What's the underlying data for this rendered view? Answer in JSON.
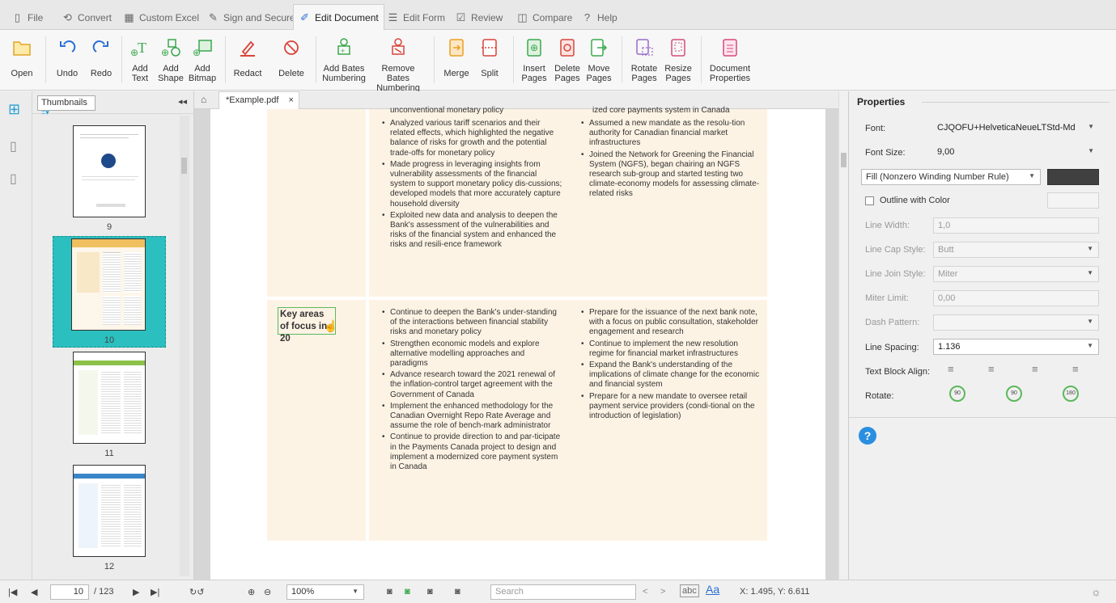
{
  "menu": {
    "tabs": [
      {
        "label": "File",
        "icon": "file-icon"
      },
      {
        "label": "Convert",
        "icon": "convert-icon"
      },
      {
        "label": "Custom Excel",
        "icon": "grid-icon"
      },
      {
        "label": "Sign and Secure",
        "icon": "pen-icon"
      },
      {
        "label": "Edit Document",
        "icon": "edit-icon"
      },
      {
        "label": "Edit Form",
        "icon": "form-icon"
      },
      {
        "label": "Review",
        "icon": "review-icon"
      },
      {
        "label": "Compare",
        "icon": "compare-icon"
      },
      {
        "label": "Help",
        "icon": "help-icon"
      }
    ],
    "active": "Edit Document"
  },
  "ribbon": {
    "open": "Open",
    "undo": "Undo",
    "redo": "Redo",
    "add_text": [
      "Add",
      "Text"
    ],
    "add_shape": [
      "Add",
      "Shape"
    ],
    "add_bitmap": [
      "Add",
      "Bitmap"
    ],
    "redact": "Redact",
    "delete": "Delete",
    "add_bates": [
      "Add Bates",
      "Numbering"
    ],
    "remove_bates": [
      "Remove Bates",
      "Numbering"
    ],
    "merge": "Merge",
    "split": "Split",
    "insert_pages": [
      "Insert",
      "Pages"
    ],
    "delete_pages": [
      "Delete",
      "Pages"
    ],
    "move_pages": [
      "Move",
      "Pages"
    ],
    "rotate_pages": [
      "Rotate",
      "Pages"
    ],
    "resize_pages": [
      "Resize",
      "Pages"
    ],
    "doc_props": [
      "Document",
      "Properties"
    ],
    "colors": {
      "orange": "#e8a020",
      "red": "#d9443a",
      "green": "#3aa84f",
      "purple": "#9a6ac8",
      "pink": "#d64a7a",
      "blue": "#2a6fd6"
    }
  },
  "thumbnails": {
    "selector": "Thumbnails",
    "pages": [
      "9",
      "10",
      "11",
      "12"
    ],
    "selected": "10",
    "highlight": "#2bbfbf"
  },
  "doc_tab": {
    "label": "*Example.pdf",
    "close": "×"
  },
  "document": {
    "top_left_partial": "unconventional monetary policy",
    "top_right_partial": "ized core payments system in Canada",
    "top_left_items": [
      "Analyzed various tariff scenarios and their related effects, which highlighted the negative balance of risks for growth and the potential trade-offs for monetary policy",
      "Made progress in leveraging insights from vulnerability assessments of the financial system to support monetary policy dis-cussions; developed models that more accurately capture household diversity",
      "Exploited new data and analysis to deepen the Bank's assessment of the vulnerabilities and risks of the financial system and enhanced the risks and resili-ence framework"
    ],
    "top_right_items": [
      "Assumed a new mandate as the resolu-tion authority for Canadian financial market infrastructures",
      "Joined the Network for Greening the Financial System (NGFS), began chairing an NGFS research sub-group and started testing two climate-economy models for assessing climate-related risks"
    ],
    "key_areas_label": "Key areas of focus in 20",
    "bottom_left_items": [
      "Continue to deepen the Bank's under-standing of the interactions between financial stability risks and monetary policy",
      "Strengthen economic models and explore alternative modelling approaches and paradigms",
      "Advance research toward the 2021 renewal of the inflation-control target agreement with the Government of Canada",
      "Implement the enhanced methodology for the Canadian Overnight Repo Rate Average and assume the role of bench-mark administrator",
      "Continue to provide direction to and par-ticipate in the Payments Canada project to design and implement a modernized core payment system in Canada"
    ],
    "bottom_right_items": [
      "Prepare for the issuance of the next bank note, with a focus on public consultation, stakeholder engagement and research",
      "Continue to implement the new resolution regime for financial market infrastructures",
      "Expand the Bank's understanding of the implications of climate change for the economic and financial system",
      "Prepare for a new mandate to oversee retail payment service providers (condi-tional on the introduction of legislation)"
    ]
  },
  "properties": {
    "title": "Properties",
    "font_label": "Font:",
    "font_value": "CJQOFU+HelveticaNeueLTStd-Md",
    "font_size_label": "Font Size:",
    "font_size_value": "9,00",
    "fill_value": "Fill (Nonzero Winding Number Rule)",
    "fill_color": "#404040",
    "outline_label": "Outline with Color",
    "line_width_label": "Line Width:",
    "line_width_value": "1,0",
    "line_cap_label": "Line Cap Style:",
    "line_cap_value": "Butt",
    "line_join_label": "Line Join Style:",
    "line_join_value": "Miter",
    "miter_label": "Miter Limit:",
    "miter_value": "0,00",
    "dash_label": "Dash Pattern:",
    "dash_value": "",
    "line_spacing_label": "Line Spacing:",
    "line_spacing_value": "1.136",
    "text_align_label": "Text Block Align:",
    "rotate_label": "Rotate:",
    "rotate_values": [
      "90",
      "90",
      "180"
    ]
  },
  "status": {
    "current_page": "10",
    "total_pages": "/ 123",
    "zoom": "100%",
    "search_placeholder": "Search",
    "abc": "abc",
    "aa": "Aa",
    "coords": "X: 1.495, Y: 6.611"
  }
}
